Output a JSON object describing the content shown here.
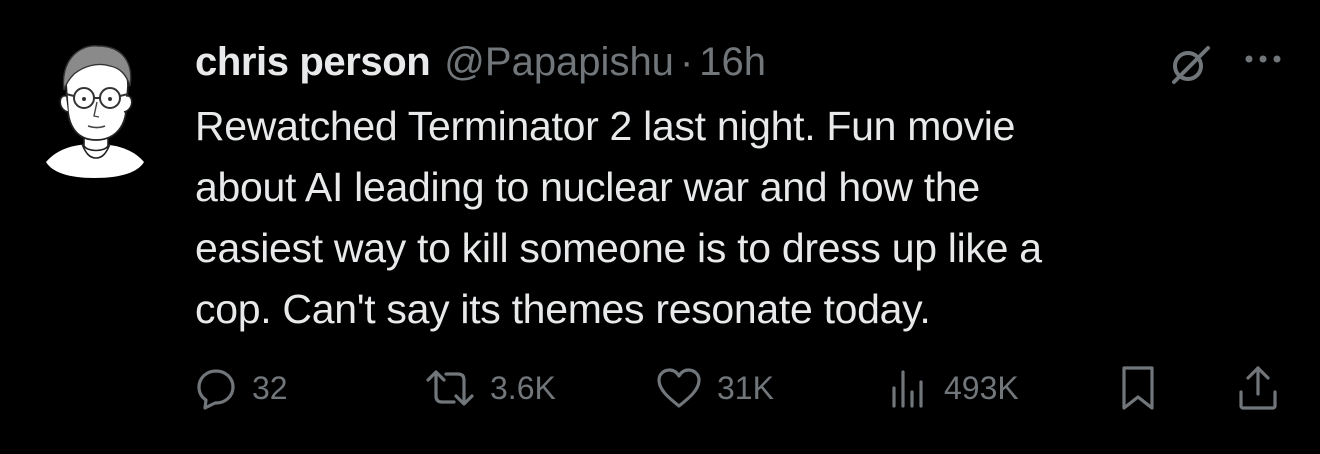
{
  "author": {
    "display_name": "chris person",
    "handle": "@Papapishu",
    "separator": "·",
    "timestamp": "16h"
  },
  "tweet": {
    "text": "Rewatched Terminator 2 last night. Fun movie\nabout AI leading to nuclear war and how the\neasiest way to kill someone is to dress up like a\ncop.  Can't say its themes resonate today."
  },
  "actions": {
    "replies": "32",
    "reposts": "3.6K",
    "likes": "31K",
    "views": "493K"
  },
  "icons": [
    "grok-icon",
    "more-icon",
    "reply-icon",
    "repost-icon",
    "like-icon",
    "views-icon",
    "bookmark-icon",
    "share-icon"
  ],
  "colors": {
    "background": "#000000",
    "primary_text": "#e7e9ea",
    "secondary_text": "#71767b"
  }
}
